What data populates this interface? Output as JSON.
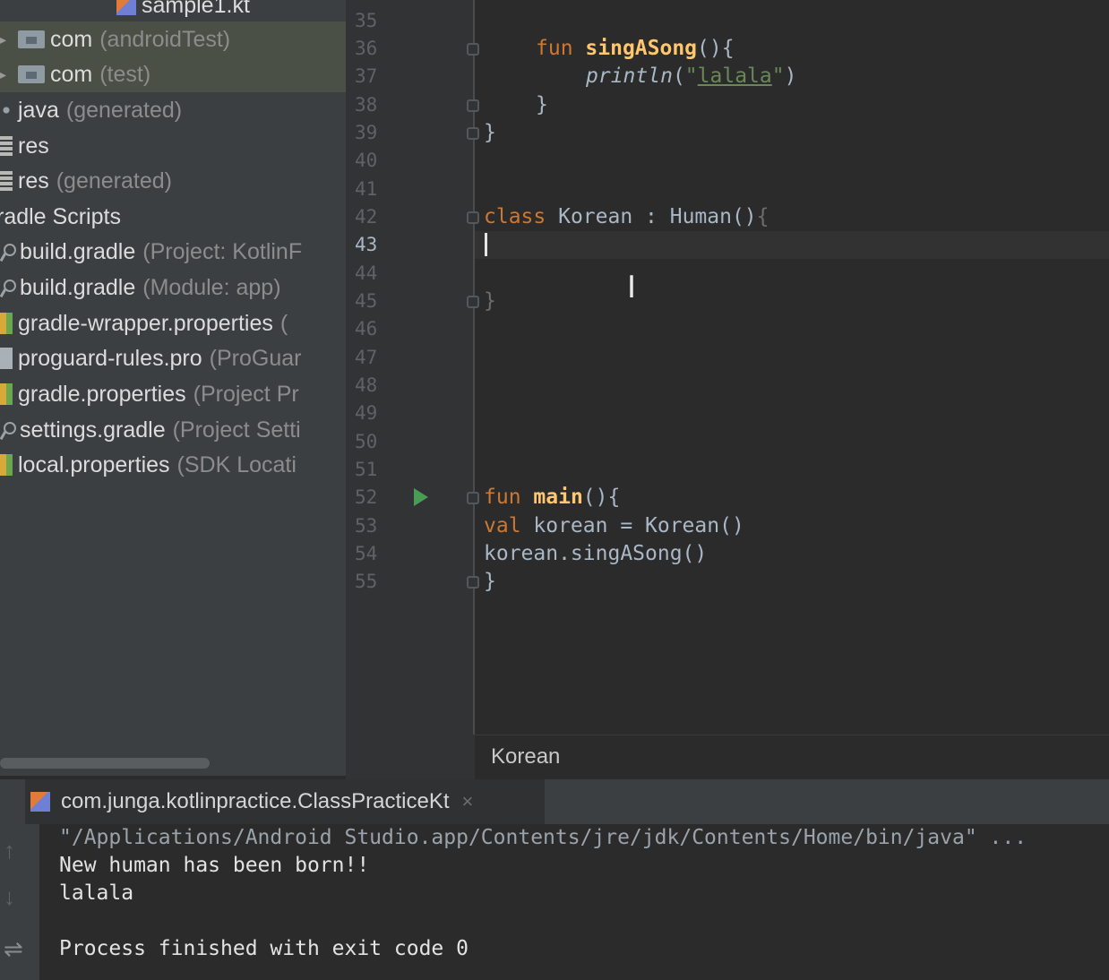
{
  "project_tree": {
    "items": [
      {
        "label": "sample1.kt",
        "hint": ""
      },
      {
        "label": "com",
        "hint": "(androidTest)"
      },
      {
        "label": "com",
        "hint": "(test)"
      },
      {
        "label": "java",
        "hint": "(generated)"
      },
      {
        "label": "res",
        "hint": ""
      },
      {
        "label": "res",
        "hint": "(generated)"
      },
      {
        "label": "radle Scripts",
        "hint": ""
      },
      {
        "label": "build.gradle",
        "hint": "(Project: KotlinF"
      },
      {
        "label": "build.gradle",
        "hint": "(Module: app)"
      },
      {
        "label": "gradle-wrapper.properties",
        "hint": "("
      },
      {
        "label": "proguard-rules.pro",
        "hint": "(ProGuar"
      },
      {
        "label": "gradle.properties",
        "hint": "(Project Pr"
      },
      {
        "label": "settings.gradle",
        "hint": "(Project Setti"
      },
      {
        "label": "local.properties",
        "hint": "(SDK Locati"
      }
    ]
  },
  "editor": {
    "line_numbers": [
      "35",
      "36",
      "37",
      "38",
      "39",
      "40",
      "41",
      "42",
      "43",
      "44",
      "45",
      "46",
      "47",
      "48",
      "49",
      "50",
      "51",
      "52",
      "53",
      "54",
      "55"
    ],
    "current_line": "43",
    "code": {
      "l36_kw": "fun",
      "l36_fn": "singASong",
      "l36_rest": "(){",
      "l37_call": "println",
      "l37_open": "(",
      "l37_q1": "\"",
      "l37_str": "lalala",
      "l37_q2": "\"",
      "l37_close": ")",
      "l38": "}",
      "l39": "}",
      "l42_kw": "class",
      "l42_rest": " Korean : Human()",
      "l42_brace": "{",
      "l45": "}",
      "l52_kw": "fun",
      "l52_fn": "main",
      "l52_rest": "(){",
      "l53_kw": "val",
      "l53_rest": " korean = Korean()",
      "l54": "korean.singASong()",
      "l55": "}"
    },
    "breadcrumb": "Korean"
  },
  "run_panel": {
    "tab_label": "com.junga.kotlinpractice.ClassPracticeKt",
    "tab_close": "×",
    "console_lines": [
      "\"/Applications/Android Studio.app/Contents/jre/jdk/Contents/Home/bin/java\" ...",
      "New human has been born!!",
      "lalala",
      "",
      "Process finished with exit code 0"
    ],
    "tools": [
      "up-arrow-icon",
      "down-arrow-icon",
      "soft-wrap-icon"
    ]
  },
  "colors": {
    "keyword": "#cc7832",
    "function": "#ffc66d",
    "string": "#6a8759",
    "text": "#a9b7c6",
    "run": "#499c54"
  }
}
